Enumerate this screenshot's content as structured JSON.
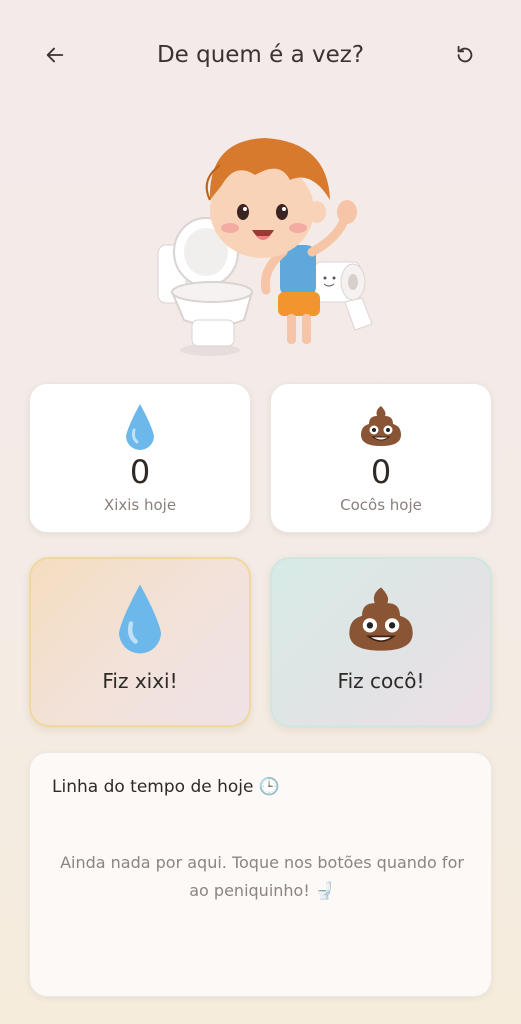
{
  "header": {
    "title": "De quem é a vez?",
    "back_icon": "arrow-left-icon",
    "reset_icon": "refresh-icon"
  },
  "stats": [
    {
      "icon": "droplet-icon",
      "value": "0",
      "label": "Xixis hoje"
    },
    {
      "icon": "poop-icon",
      "value": "0",
      "label": "Cocôs hoje"
    }
  ],
  "actions": [
    {
      "icon": "droplet-icon",
      "label": "Fiz xixi!"
    },
    {
      "icon": "poop-icon",
      "label": "Fiz cocô!"
    }
  ],
  "timeline": {
    "title": "Linha do tempo de hoje 🕒",
    "empty_message": "Ainda nada por aqui. Toque nos botões quando for ao peniquinho! 🚽"
  },
  "colors": {
    "water": "#6db8ea",
    "poop": "#8a5534",
    "xixi_border": "#f1d79e",
    "coco_border": "#cfe6e2"
  }
}
